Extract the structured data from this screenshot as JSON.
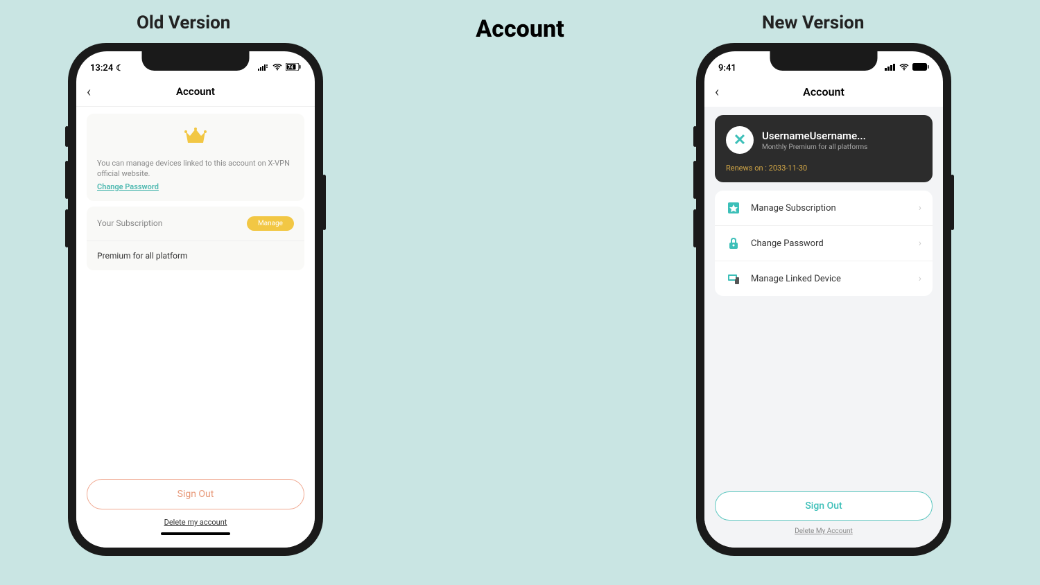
{
  "page": {
    "title": "Account",
    "old_label": "Old Version",
    "new_label": "New Version"
  },
  "old": {
    "status": {
      "time": "13:24",
      "battery": "74"
    },
    "nav": {
      "title": "Account"
    },
    "card": {
      "desc": "You can manage devices linked to this account on X-VPN official website.",
      "change_pw": "Change Password"
    },
    "subscription": {
      "label": "Your Subscription",
      "manage": "Manage",
      "plan": "Premium for all platform"
    },
    "signout": "Sign Out",
    "delete": "Delete my account"
  },
  "new": {
    "status": {
      "time": "9:41"
    },
    "nav": {
      "title": "Account"
    },
    "user": {
      "name": "UsernameUsername...",
      "plan": "Monthly Premium for all platforms",
      "renews": "Renews on : 2033-11-30"
    },
    "menu": {
      "manage_sub": "Manage Subscription",
      "change_pw": "Change Password",
      "manage_device": "Manage Linked Device"
    },
    "signout": "Sign Out",
    "delete": "Delete My Account"
  }
}
